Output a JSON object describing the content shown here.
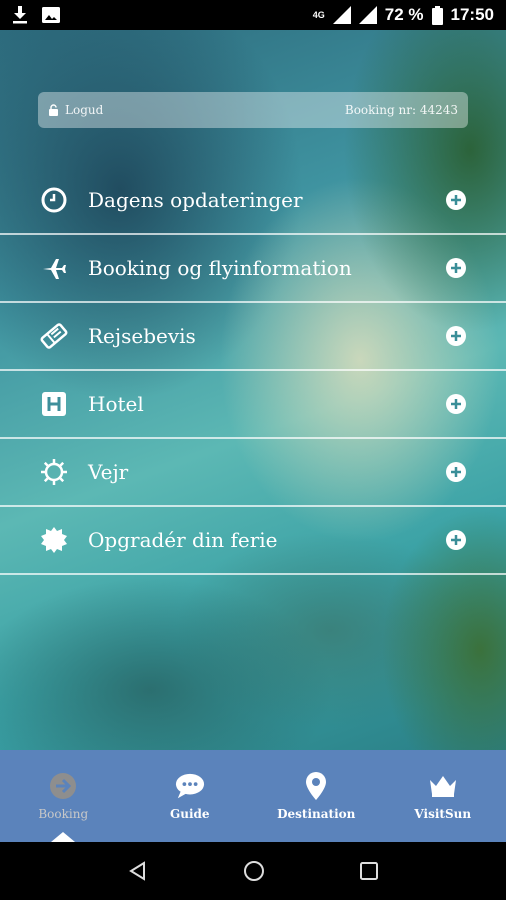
{
  "status_bar": {
    "network": "4G",
    "battery": "72 %",
    "time": "17:50"
  },
  "header": {
    "logout_label": "Logud",
    "booking_nr": "Booking nr: 44243"
  },
  "menu": {
    "items": [
      {
        "label": "Dagens opdateringer",
        "icon": "clock-icon"
      },
      {
        "label": "Booking og flyinformation",
        "icon": "airplane-icon"
      },
      {
        "label": "Rejsebevis",
        "icon": "ticket-icon"
      },
      {
        "label": "Hotel",
        "icon": "hotel-icon"
      },
      {
        "label": "Vejr",
        "icon": "sun-icon"
      },
      {
        "label": "Opgradér din ferie",
        "icon": "badge-icon"
      }
    ]
  },
  "bottom_nav": {
    "tabs": [
      {
        "label": "Booking",
        "icon": "arrow-circle-icon",
        "active": true
      },
      {
        "label": "Guide",
        "icon": "chat-bubble-icon",
        "active": false
      },
      {
        "label": "Destination",
        "icon": "location-pin-icon",
        "active": false
      },
      {
        "label": "VisitSun",
        "icon": "crown-icon",
        "active": false
      }
    ]
  },
  "colors": {
    "nav_background": "#5b83bb",
    "accent_white": "#ffffff"
  }
}
